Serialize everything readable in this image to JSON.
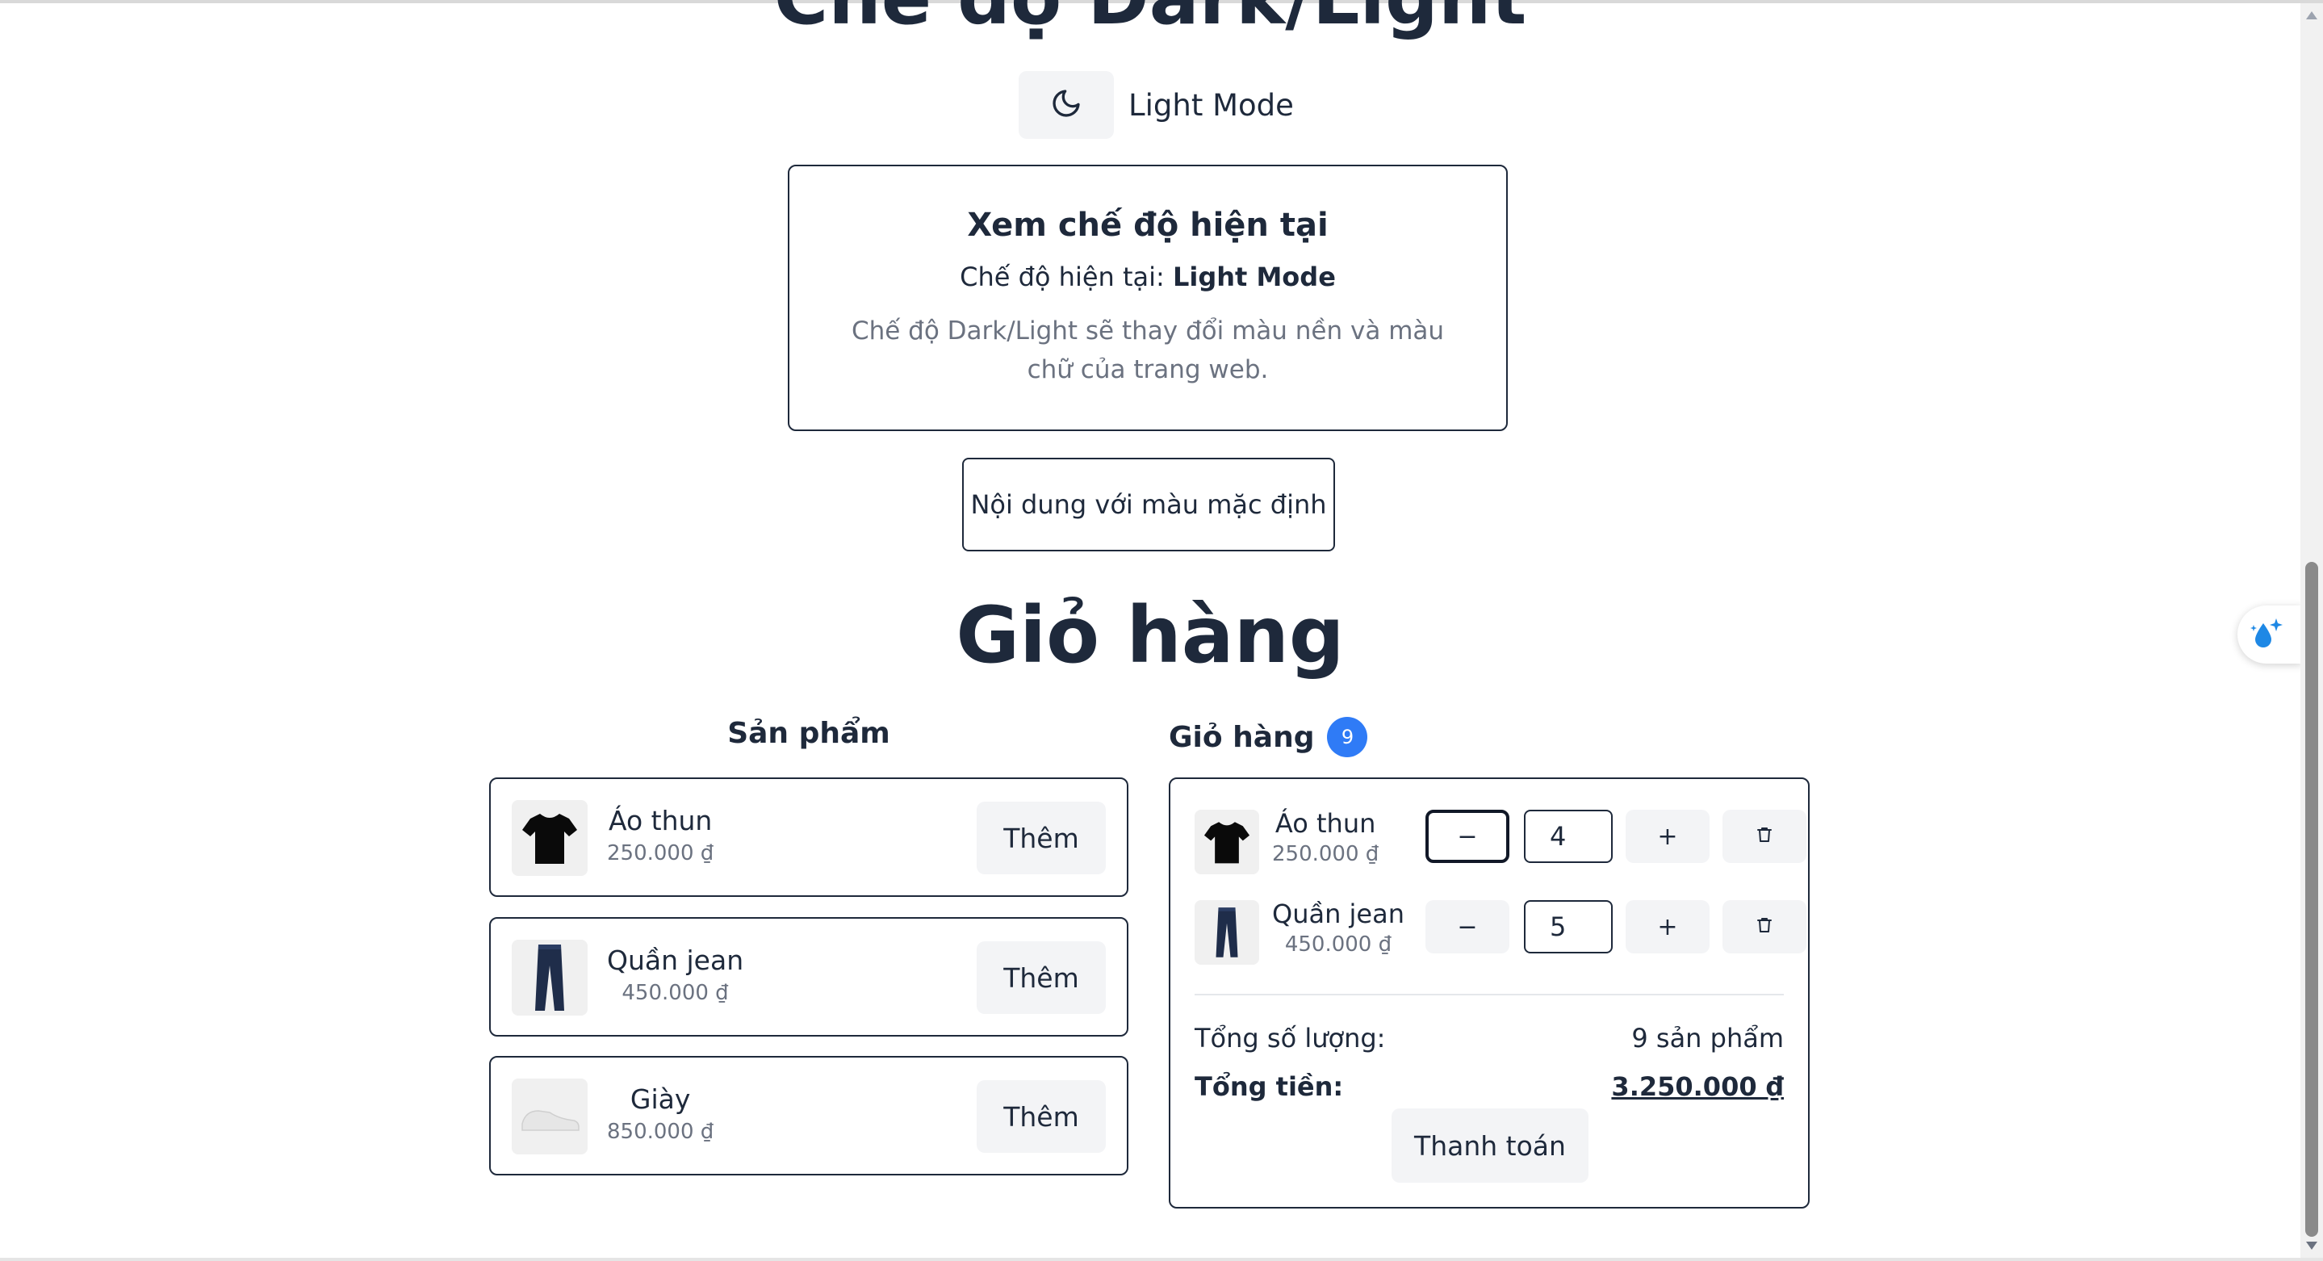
{
  "theme": {
    "title": "Chế độ Dark/Light",
    "mode_label": "Light Mode"
  },
  "current_mode_card": {
    "title": "Xem chế độ hiện tại",
    "current_prefix": "Chế độ hiện tại:",
    "current_value": "Light Mode",
    "description": "Chế độ Dark/Light sẽ thay đổi màu nền và màu chữ của trang web."
  },
  "default_box": "Nội dung với màu mặc định",
  "cart_section_title": "Giỏ hàng",
  "products": {
    "heading": "Sản phẩm",
    "items": [
      {
        "name": "Áo thun",
        "price": "250.000 ₫",
        "button": "Thêm"
      },
      {
        "name": "Quần jean",
        "price": "450.000 ₫",
        "button": "Thêm"
      },
      {
        "name": "Giày",
        "price": "850.000 ₫",
        "button": "Thêm"
      }
    ]
  },
  "cart": {
    "heading": "Giỏ hàng",
    "badge": "9",
    "items": [
      {
        "name": "Áo thun",
        "price": "250.000 ₫",
        "quantity": "4",
        "minus": "−",
        "plus": "+"
      },
      {
        "name": "Quần jean",
        "price": "450.000 ₫",
        "quantity": "5",
        "minus": "−",
        "plus": "+"
      }
    ],
    "total_quantity_label": "Tổng số lượng:",
    "total_quantity_value": "9 sản phẩm",
    "total_price_label": "Tổng tiền:",
    "total_price_value": "3.250.000 ₫",
    "checkout": "Thanh toán"
  },
  "colors": {
    "text": "#1e293b",
    "muted": "#6b7280",
    "button_bg": "#f3f4f6",
    "badge": "#2f7bf6",
    "border": "#1e293b"
  }
}
